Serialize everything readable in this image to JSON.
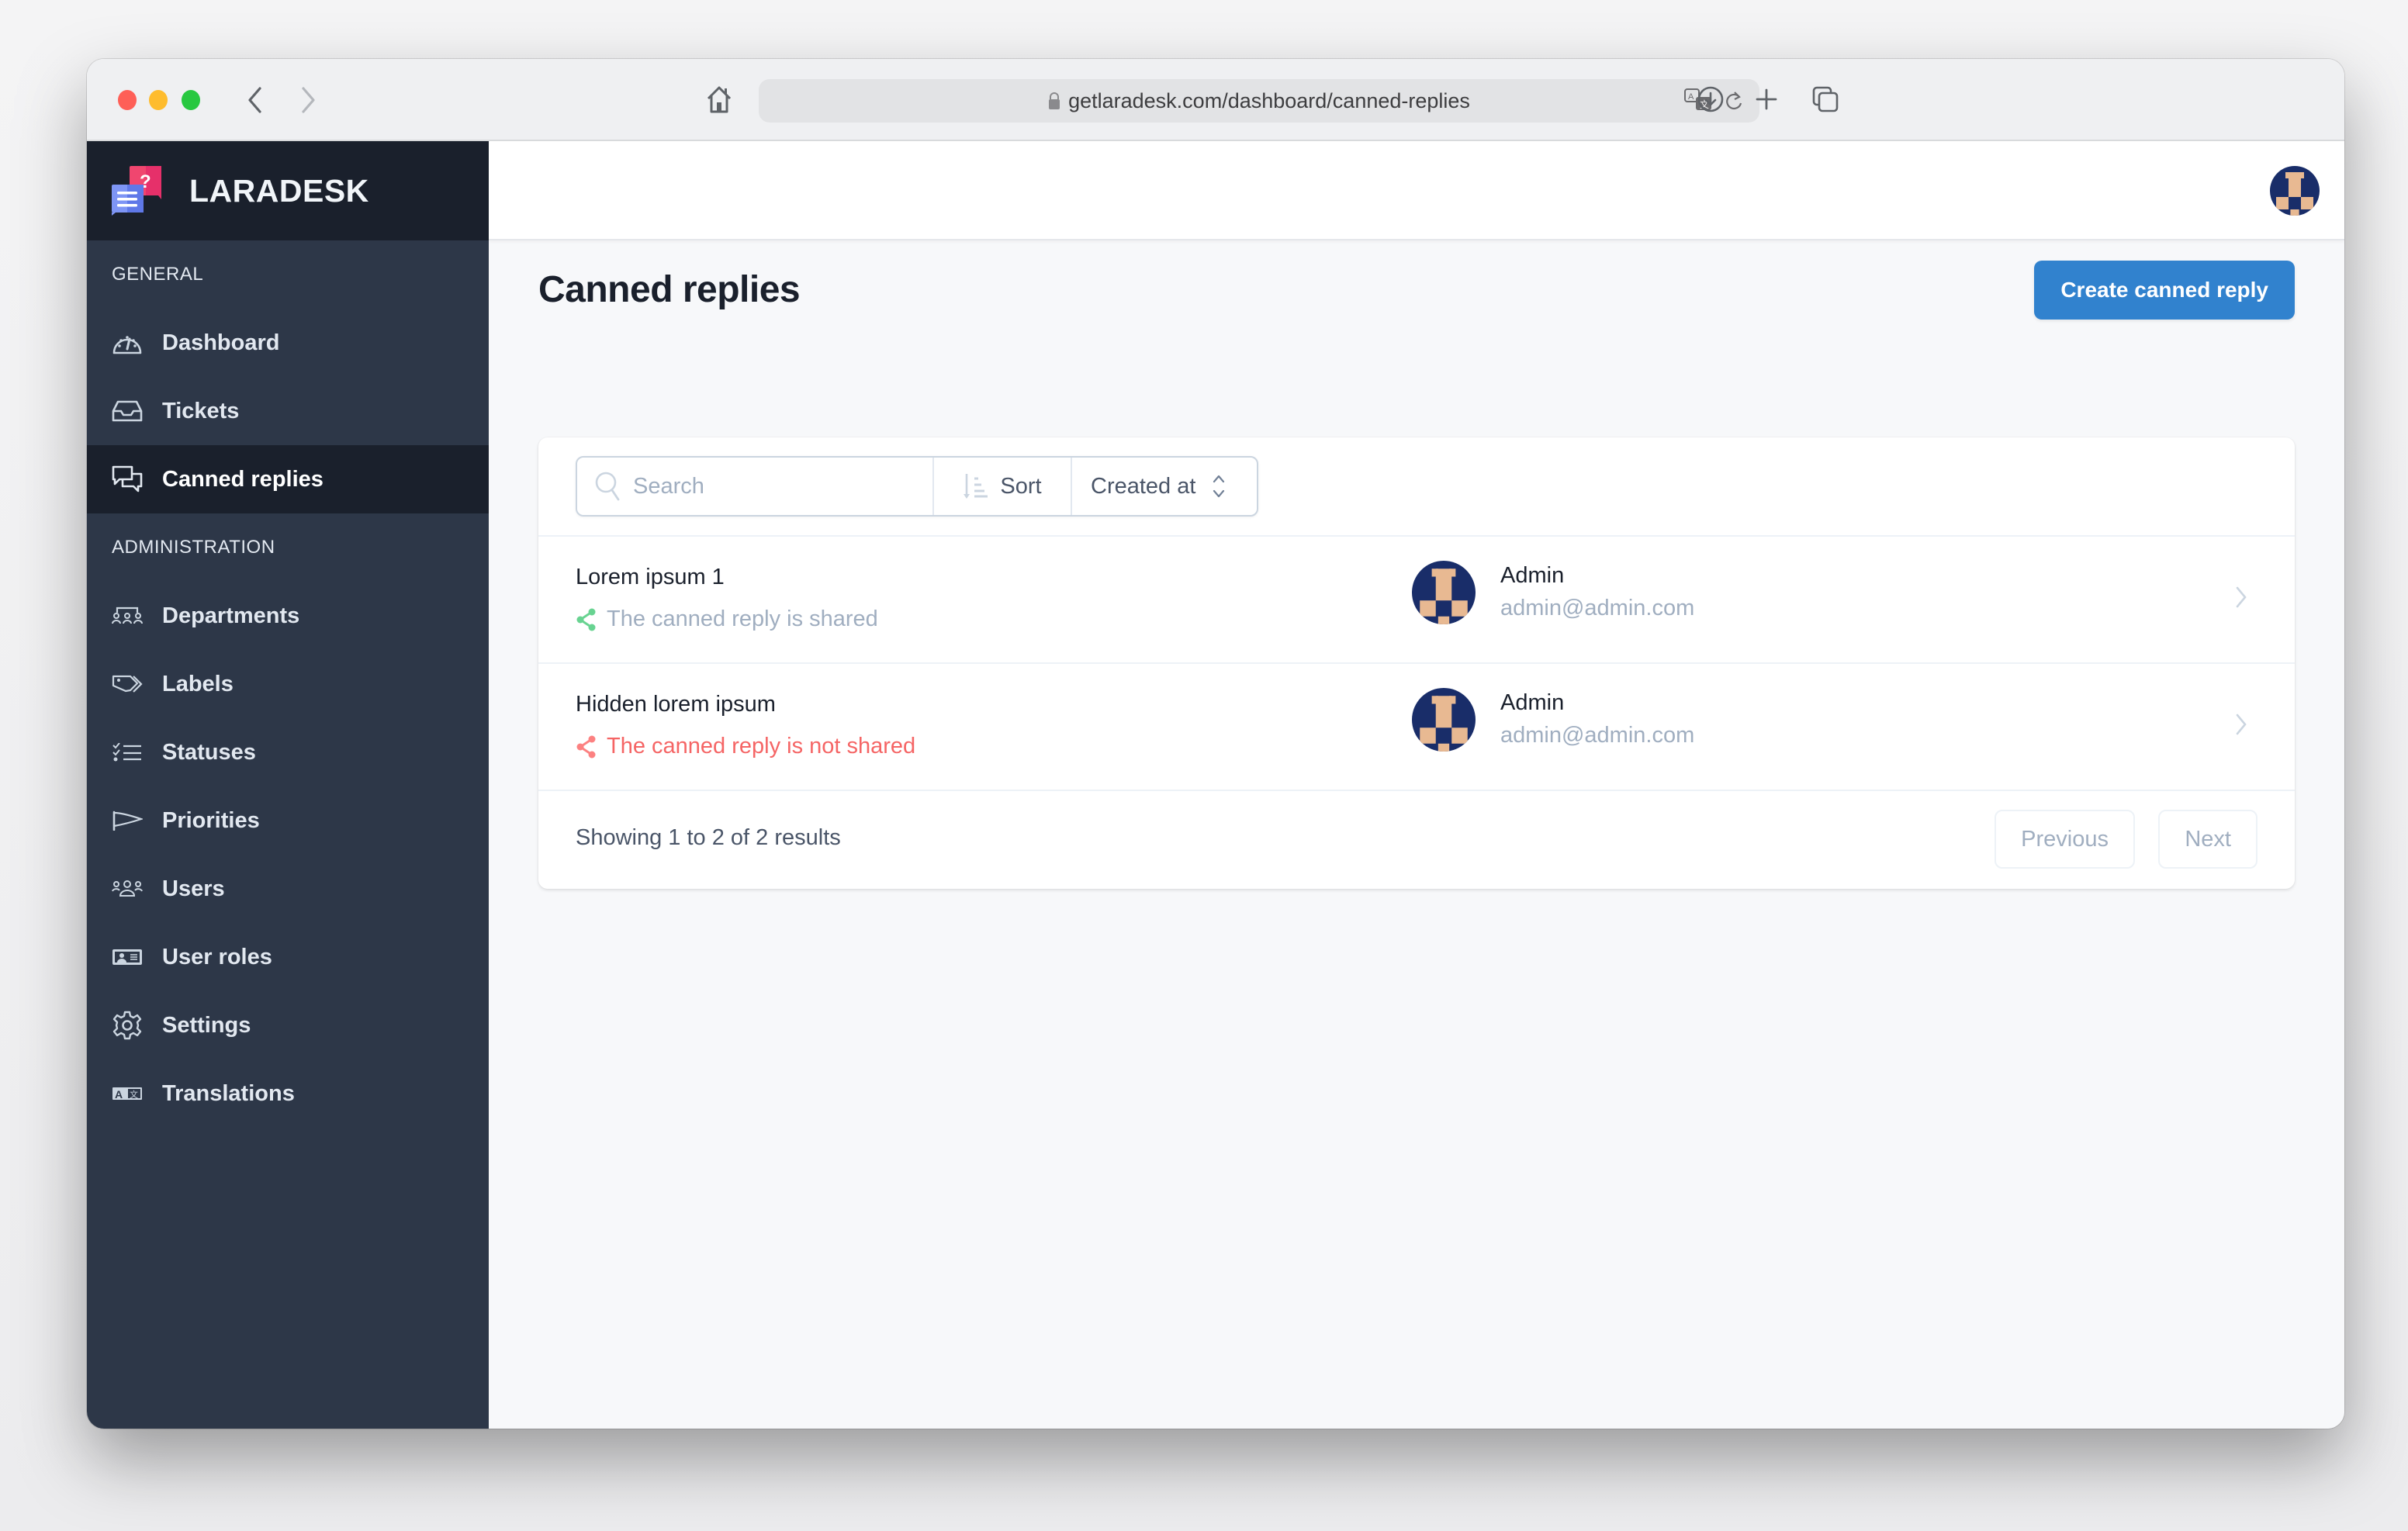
{
  "browser": {
    "url": "getlaradesk.com/dashboard/canned-replies"
  },
  "brand": {
    "name": "LARADESK"
  },
  "sidebar": {
    "sections": [
      {
        "label": "GENERAL",
        "items": [
          {
            "label": "Dashboard",
            "icon": "gauge-icon",
            "active": false
          },
          {
            "label": "Tickets",
            "icon": "inbox-icon",
            "active": false
          },
          {
            "label": "Canned replies",
            "icon": "chat-bubbles-icon",
            "active": true
          }
        ]
      },
      {
        "label": "ADMINISTRATION",
        "items": [
          {
            "label": "Departments",
            "icon": "user-group-icon",
            "active": false
          },
          {
            "label": "Labels",
            "icon": "tags-icon",
            "active": false
          },
          {
            "label": "Statuses",
            "icon": "checklist-icon",
            "active": false
          },
          {
            "label": "Priorities",
            "icon": "flag-icon",
            "active": false
          },
          {
            "label": "Users",
            "icon": "users-icon",
            "active": false
          },
          {
            "label": "User roles",
            "icon": "id-card-icon",
            "active": false
          },
          {
            "label": "Settings",
            "icon": "gear-icon",
            "active": false
          },
          {
            "label": "Translations",
            "icon": "translate-icon",
            "active": false
          }
        ]
      }
    ]
  },
  "page": {
    "title": "Canned replies",
    "create_button": "Create canned reply",
    "search_placeholder": "Search",
    "search_value": "",
    "sort_label": "Sort",
    "sort_field": "Created at"
  },
  "replies": [
    {
      "title": "Lorem ipsum 1",
      "status": "The canned reply is shared",
      "shared": true,
      "user_name": "Admin",
      "user_email": "admin@admin.com"
    },
    {
      "title": "Hidden lorem ipsum",
      "status": "The canned reply is not shared",
      "shared": false,
      "user_name": "Admin",
      "user_email": "admin@admin.com"
    }
  ],
  "pagination": {
    "summary": "Showing 1 to 2 of 2 results",
    "previous": "Previous",
    "next": "Next"
  },
  "colors": {
    "accent": "#3182ce",
    "shared": "#68d391",
    "not_shared": "#f56565",
    "sidebar_bg": "#2d3748",
    "sidebar_dark": "#1a202c"
  }
}
